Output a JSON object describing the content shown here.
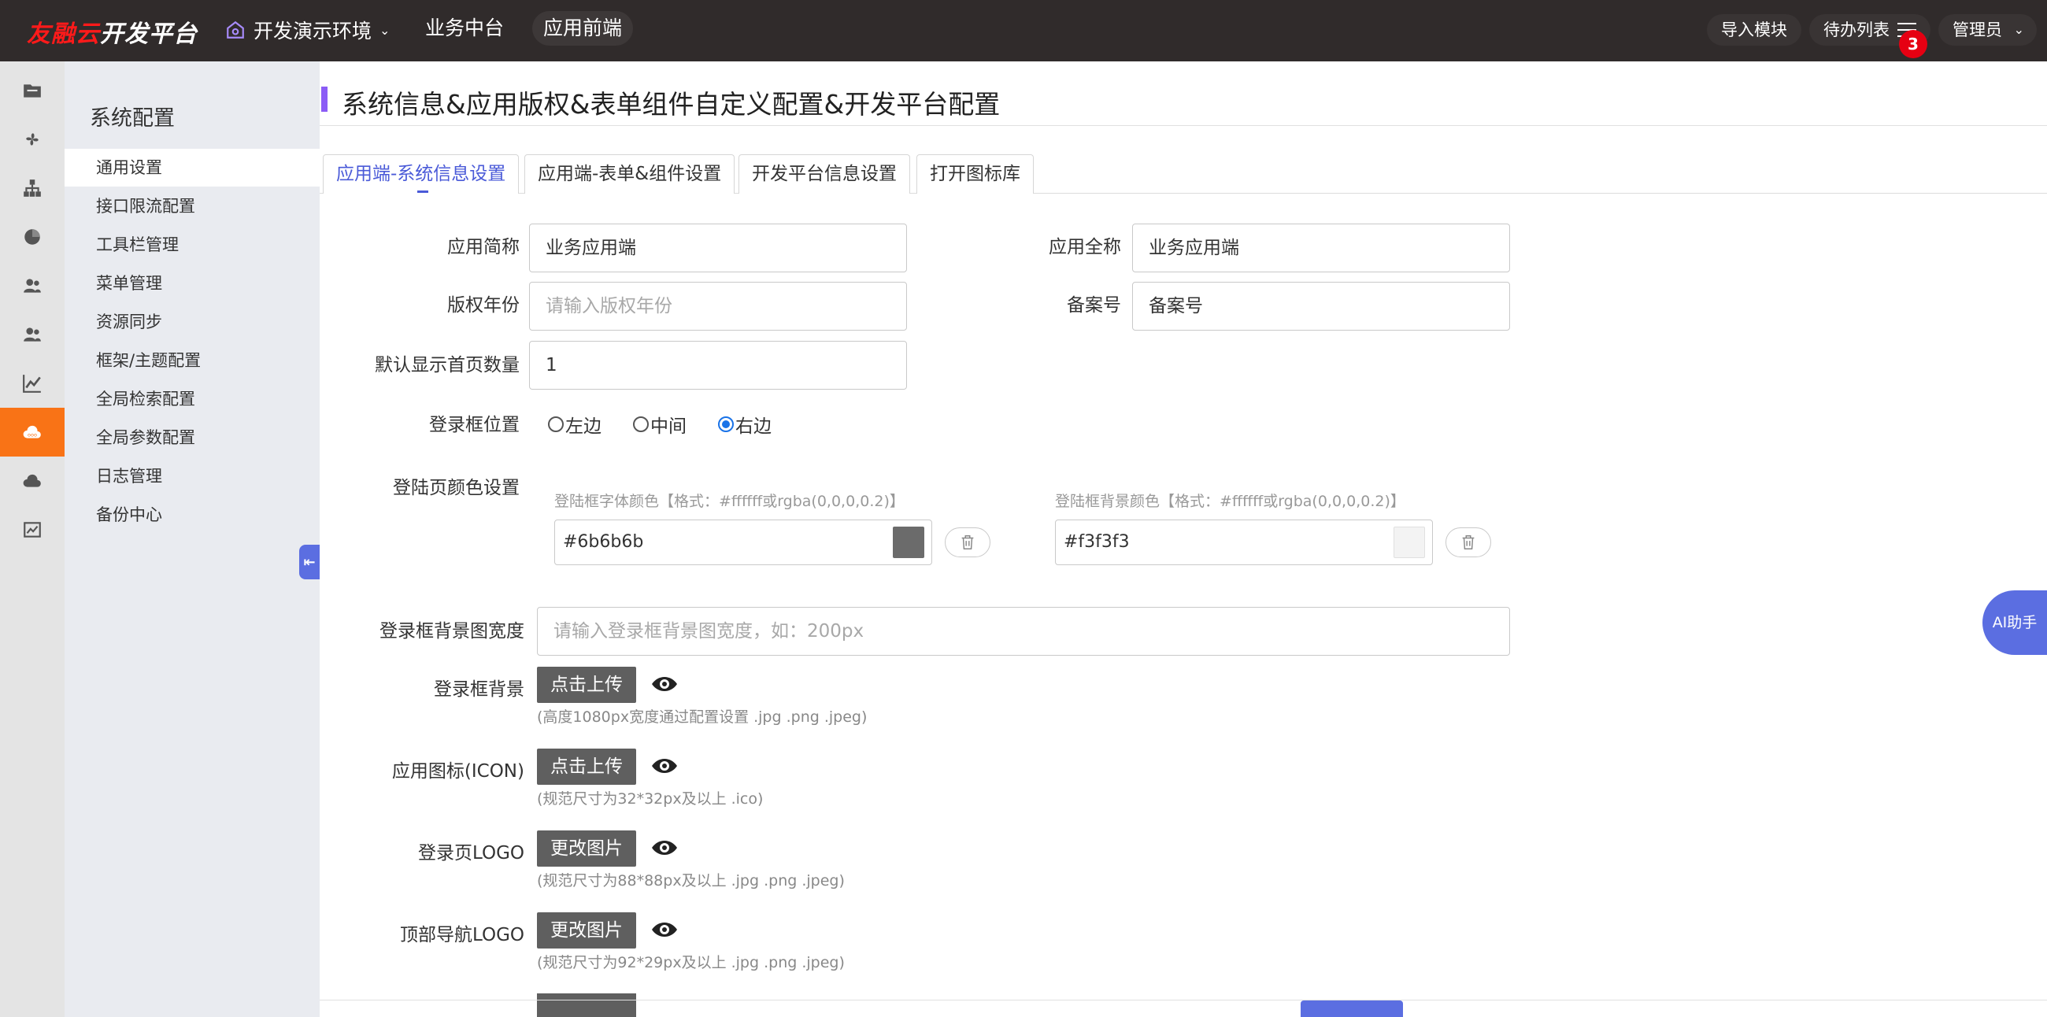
{
  "header": {
    "brand": "友融云",
    "platform": "开发平台",
    "env": "开发演示环境",
    "nav": [
      "业务中台",
      "应用前端"
    ],
    "import_module": "导入模块",
    "todo": "待办列表",
    "todo_count": "3",
    "user": "管理员"
  },
  "submenu": {
    "title": "系统配置",
    "items": [
      "通用设置",
      "接口限流配置",
      "工具栏管理",
      "菜单管理",
      "资源同步",
      "框架/主题配置",
      "全局检索配置",
      "全局参数配置",
      "日志管理",
      "备份中心"
    ]
  },
  "page": {
    "title": "系统信息&应用版权&表单组件自定义配置&开发平台配置"
  },
  "tabs": [
    "应用端-系统信息设置",
    "应用端-表单&组件设置",
    "开发平台信息设置",
    "打开图标库"
  ],
  "form": {
    "app_short_label": "应用简称",
    "app_short_value": "业务应用端",
    "app_full_label": "应用全称",
    "app_full_value": "业务应用端",
    "copyright_label": "版权年份",
    "copyright_placeholder": "请输入版权年份",
    "record_label": "备案号",
    "record_value": "备案号",
    "home_count_label": "默认显示首页数量",
    "home_count_value": "1",
    "login_pos_label": "登录框位置",
    "login_pos_options": [
      "左边",
      "中间",
      "右边"
    ],
    "login_pos_selected": "右边",
    "login_color_label": "登陆页颜色设置",
    "font_color_hint": "登陆框字体颜色【格式：#ffffff或rgba(0,0,0,0.2)】",
    "font_color_value": "#6b6b6b",
    "bg_color_hint": "登陆框背景颜色【格式：#ffffff或rgba(0,0,0,0.2)】",
    "bg_color_value": "#f3f3f3",
    "bg_width_label": "登录框背景图宽度",
    "bg_width_placeholder": "请输入登录框背景图宽度，如：200px",
    "uploads": [
      {
        "label": "登录框背景",
        "button": "点击上传",
        "help": "(高度1080px宽度通过配置设置 .jpg .png .jpeg)"
      },
      {
        "label": "应用图标(ICON)",
        "button": "点击上传",
        "help": "(规范尺寸为32*32px及以上 .ico)"
      },
      {
        "label": "登录页LOGO",
        "button": "更改图片",
        "help": "(规范尺寸为88*88px及以上 .jpg .png .jpeg)"
      },
      {
        "label": "顶部导航LOGO",
        "button": "更改图片",
        "help": "(规范尺寸为92*29px及以上 .jpg .png .jpeg)"
      }
    ]
  },
  "ai_button": "AI助手",
  "colors": {
    "topbar": "#302b2b",
    "accent": "#5b6ee1",
    "rail_active": "#f97316",
    "brand_red": "#ff1a1a"
  }
}
